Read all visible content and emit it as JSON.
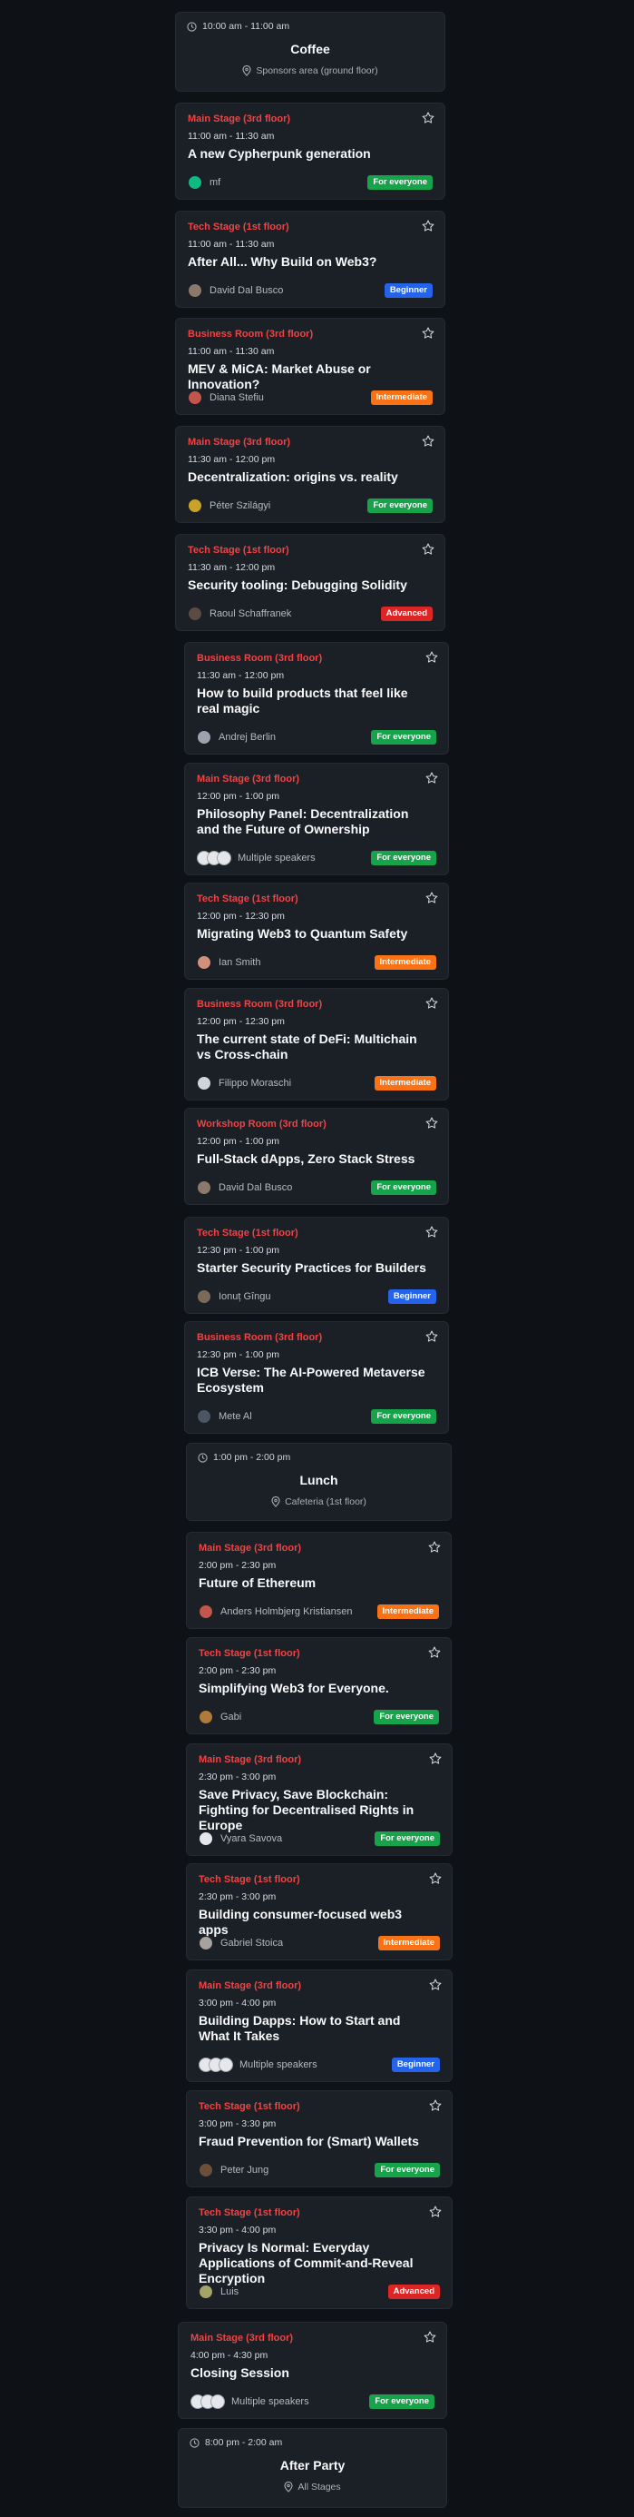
{
  "colors": {
    "background": "#0e1116",
    "card": "#1b1f26",
    "stage_red": "#ef4444",
    "badge_for_everyone": "#16a34a",
    "badge_beginner": "#2563eb",
    "badge_intermediate": "#f97316",
    "badge_advanced": "#dc2626"
  },
  "breaks": [
    {
      "time": "10:00 am - 11:00 am",
      "title": "Coffee",
      "location": "Sponsors area (ground floor)"
    },
    {
      "time": "1:00 pm - 2:00 pm",
      "title": "Lunch",
      "location": "Cafeteria (1st floor)"
    },
    {
      "time": "8:00 pm - 2:00 am",
      "title": "After Party",
      "location": "All Stages"
    }
  ],
  "sessions": [
    {
      "stage": "Main Stage (3rd floor)",
      "time": "11:00 am - 11:30 am",
      "title": "A new Cypherpunk generation",
      "speaker": "mf",
      "level": "For everyone"
    },
    {
      "stage": "Tech Stage (1st floor)",
      "time": "11:00 am - 11:30 am",
      "title": "After All... Why Build on Web3?",
      "speaker": "David Dal Busco",
      "level": "Beginner"
    },
    {
      "stage": "Business Room (3rd floor)",
      "time": "11:00 am - 11:30 am",
      "title": "MEV & MiCA: Market Abuse or Innovation?",
      "speaker": "Diana Stefiu",
      "level": "Intermediate"
    },
    {
      "stage": "Main Stage (3rd floor)",
      "time": "11:30 am - 12:00 pm",
      "title": "Decentralization: origins vs. reality",
      "speaker": "Péter Szilágyi",
      "level": "For everyone"
    },
    {
      "stage": "Tech Stage (1st floor)",
      "time": "11:30 am - 12:00 pm",
      "title": "Security tooling: Debugging Solidity",
      "speaker": "Raoul Schaffranek",
      "level": "Advanced"
    },
    {
      "stage": "Business Room (3rd floor)",
      "time": "11:30 am - 12:00 pm",
      "title": "How to build products that feel like real magic",
      "speaker": "Andrej Berlin",
      "level": "For everyone"
    },
    {
      "stage": "Main Stage (3rd floor)",
      "time": "12:00 pm - 1:00 pm",
      "title": "Philosophy Panel: Decentralization and the Future of Ownership",
      "speaker": "Multiple speakers",
      "level": "For everyone"
    },
    {
      "stage": "Tech Stage (1st floor)",
      "time": "12:00 pm - 12:30 pm",
      "title": "Migrating Web3 to Quantum Safety",
      "speaker": "Ian Smith",
      "level": "Intermediate"
    },
    {
      "stage": "Business Room (3rd floor)",
      "time": "12:00 pm - 12:30 pm",
      "title": "The current state of DeFi: Multichain vs Cross-chain",
      "speaker": "Filippo Moraschi",
      "level": "Intermediate"
    },
    {
      "stage": "Workshop Room (3rd floor)",
      "time": "12:00 pm - 1:00 pm",
      "title": "Full-Stack dApps, Zero Stack Stress",
      "speaker": "David Dal Busco",
      "level": "For everyone"
    },
    {
      "stage": "Tech Stage (1st floor)",
      "time": "12:30 pm - 1:00 pm",
      "title": "Starter Security Practices for Builders",
      "speaker": "Ionuț Gîngu",
      "level": "Beginner"
    },
    {
      "stage": "Business Room (3rd floor)",
      "time": "12:30 pm - 1:00 pm",
      "title": "ICB Verse: The AI-Powered Metaverse Ecosystem",
      "speaker": "Mete Al",
      "level": "For everyone"
    },
    {
      "stage": "Main Stage (3rd floor)",
      "time": "2:00 pm - 2:30 pm",
      "title": "Future of Ethereum",
      "speaker": "Anders Holmbjerg Kristiansen",
      "level": "Intermediate"
    },
    {
      "stage": "Tech Stage (1st floor)",
      "time": "2:00 pm - 2:30 pm",
      "title": "Simplifying Web3 for Everyone.",
      "speaker": "Gabi",
      "level": "For everyone"
    },
    {
      "stage": "Main Stage (3rd floor)",
      "time": "2:30 pm - 3:00 pm",
      "title": "Save Privacy, Save Blockchain: Fighting for Decentralised Rights in Europe",
      "speaker": "Vyara Savova",
      "level": "For everyone"
    },
    {
      "stage": "Tech Stage (1st floor)",
      "time": "2:30 pm - 3:00 pm",
      "title": "Building consumer-focused web3 apps",
      "speaker": "Gabriel Stoica",
      "level": "Intermediate"
    },
    {
      "stage": "Main Stage (3rd floor)",
      "time": "3:00 pm - 4:00 pm",
      "title": "Building Dapps: How to Start and What It Takes",
      "speaker": "Multiple speakers",
      "level": "Beginner"
    },
    {
      "stage": "Tech Stage (1st floor)",
      "time": "3:00 pm - 3:30 pm",
      "title": "Fraud Prevention for (Smart) Wallets",
      "speaker": "Peter Jung",
      "level": "For everyone"
    },
    {
      "stage": "Tech Stage (1st floor)",
      "time": "3:30 pm - 4:00 pm",
      "title": "Privacy Is Normal: Everyday Applications of Commit-and-Reveal Encryption",
      "speaker": "Luis",
      "level": "Advanced"
    },
    {
      "stage": "Main Stage (3rd floor)",
      "time": "4:00 pm - 4:30 pm",
      "title": "Closing Session",
      "speaker": "Multiple speakers",
      "level": "For everyone"
    }
  ]
}
